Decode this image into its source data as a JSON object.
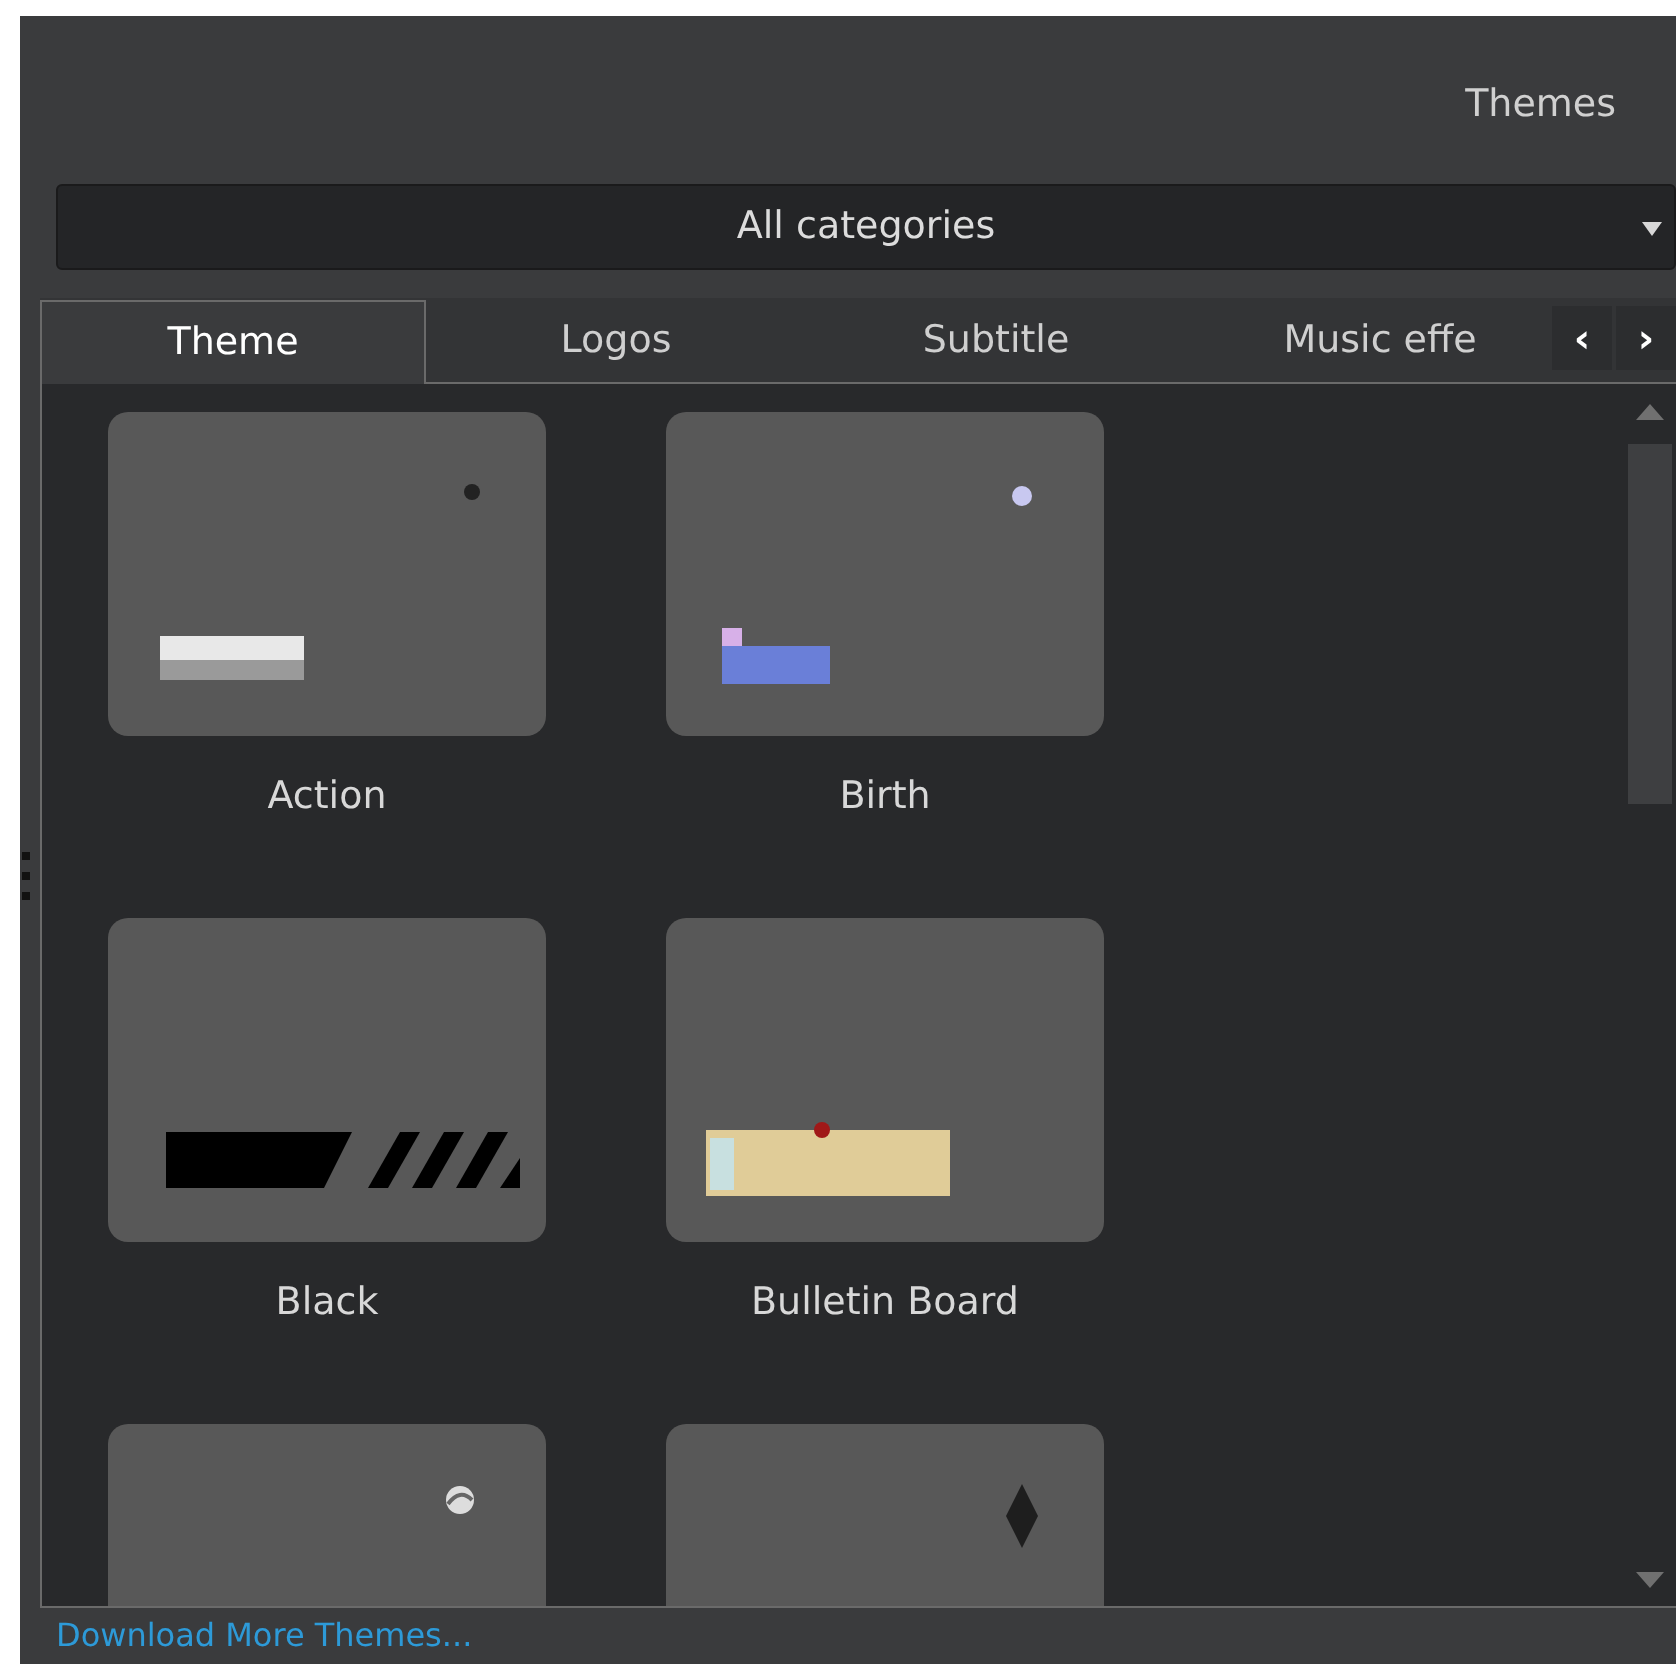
{
  "panel": {
    "title": "Themes"
  },
  "category_dropdown": {
    "value": "All categories"
  },
  "tabs": [
    {
      "label": "Theme",
      "selected": true
    },
    {
      "label": "Logos",
      "selected": false
    },
    {
      "label": "Subtitle",
      "selected": false
    },
    {
      "label": "Music effe",
      "selected": false
    }
  ],
  "tab_scroll": [
    "‹",
    "›"
  ],
  "themes": [
    {
      "kind": "picture",
      "label": "Action"
    },
    {
      "kind": "picture",
      "label": "Birth"
    },
    {
      "kind": "picture",
      "label": "Black"
    },
    {
      "kind": "picture",
      "label": "Bulletin Board"
    },
    {
      "kind": "picture"
    },
    {
      "kind": "picture"
    }
  ],
  "link": "Download More Themes..."
}
